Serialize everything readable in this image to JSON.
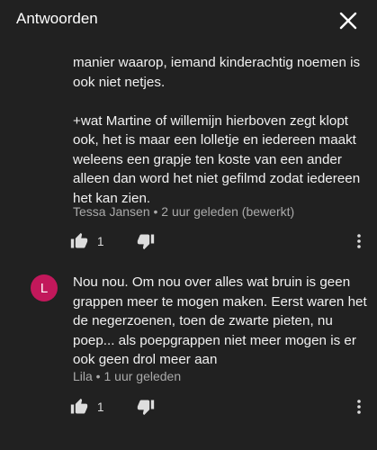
{
  "header": {
    "title": "Antwoorden"
  },
  "comments": [
    {
      "text": "manier waarop, iemand kinderachtig noemen is ook niet netjes.\n\n+wat Martine of willemijn hierboven zegt klopt ook, het is maar een lolletje en iedereen maakt weleens een grapje ten koste van een ander alleen dan word het niet gefilmd zodat iedereen het kan zien.",
      "author": "Tessa Jansen",
      "time": " • 2 uur geleden (bewerkt)",
      "likes": "1"
    },
    {
      "avatar_letter": "L",
      "avatar_color": "#c2185b",
      "text": "Nou nou. Om nou over alles wat bruin is geen grappen meer te mogen maken. Eerst waren het de negerzoenen, toen de zwarte pieten, nu poep... als poepgrappen niet meer mogen is er ook geen drol meer aan",
      "author": "Lila",
      "time": " • 1 uur geleden",
      "likes": "1"
    }
  ],
  "icons": {
    "close": "close-icon",
    "like": "thumb-up-icon",
    "dislike": "thumb-down-icon",
    "more": "more-vert-icon"
  }
}
